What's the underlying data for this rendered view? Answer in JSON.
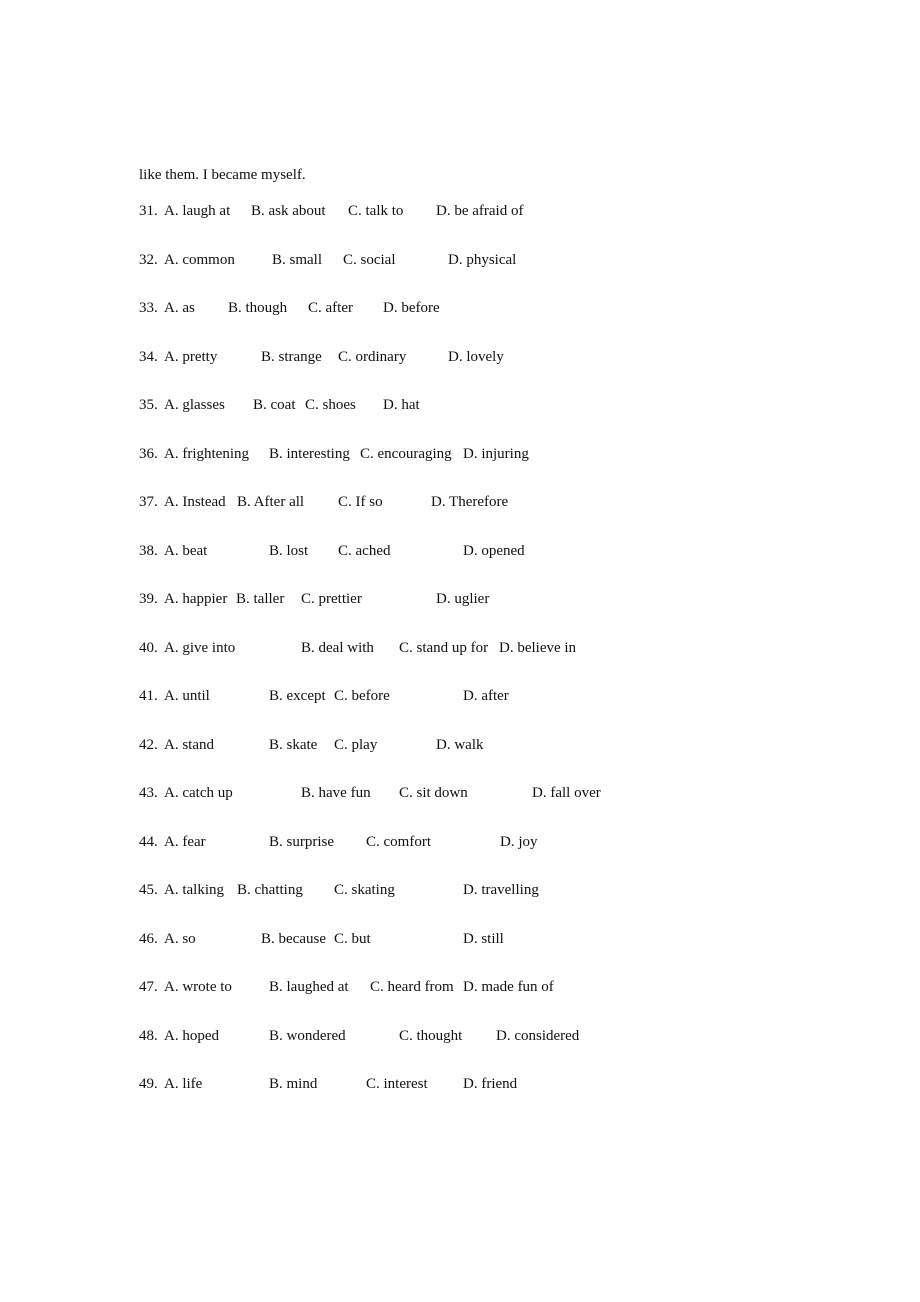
{
  "intro_line": "like them. I became myself.",
  "questions": [
    {
      "num": "31.",
      "options": [
        "A. laugh at",
        "B. ask about",
        "C. talk to",
        "D. be afraid of"
      ]
    },
    {
      "num": "32.",
      "options": [
        "A. common",
        "B. small",
        "C. social",
        "D. physical"
      ]
    },
    {
      "num": "33.",
      "options": [
        "A. as",
        "B. though",
        "C. after",
        "D. before"
      ]
    },
    {
      "num": "34.",
      "options": [
        "A. pretty",
        "B. strange",
        "C. ordinary",
        "D. lovely"
      ]
    },
    {
      "num": "35.",
      "options": [
        "A. glasses",
        "B. coat",
        "C. shoes",
        "D. hat"
      ]
    },
    {
      "num": "36.",
      "options": [
        "A. frightening",
        "B. interesting",
        "C. encouraging",
        "D. injuring"
      ]
    },
    {
      "num": "37.",
      "options": [
        "A. Instead",
        "B. After all",
        "C. If so",
        "D. Therefore"
      ]
    },
    {
      "num": "38.",
      "options": [
        "A. beat",
        "B. lost",
        "C. ached",
        "D. opened"
      ]
    },
    {
      "num": "39.",
      "options": [
        "A. happier",
        "B. taller",
        "C. prettier",
        "D. uglier"
      ]
    },
    {
      "num": "40.",
      "options": [
        "A. give into",
        "B. deal with",
        "C. stand up for",
        "D. believe in"
      ]
    },
    {
      "num": "41.",
      "options": [
        "A. until",
        "B. except",
        "C. before",
        "D. after"
      ]
    },
    {
      "num": "42.",
      "options": [
        "A. stand",
        "B. skate",
        "C. play",
        "D. walk"
      ]
    },
    {
      "num": "43.",
      "options": [
        "A. catch up",
        "B. have fun",
        "C. sit down",
        "D. fall over"
      ]
    },
    {
      "num": "44.",
      "options": [
        "A. fear",
        "B. surprise",
        "C. comfort",
        "D. joy"
      ]
    },
    {
      "num": "45.",
      "options": [
        "A. talking",
        "B. chatting",
        "C. skating",
        "D. travelling"
      ]
    },
    {
      "num": "46.",
      "options": [
        "A. so",
        "B. because",
        "C. but",
        "D. still"
      ]
    },
    {
      "num": "47.",
      "options": [
        "A. wrote to",
        "B. laughed at",
        "C. heard from",
        "D. made fun of"
      ]
    },
    {
      "num": "48.",
      "options": [
        "A. hoped",
        "B. wondered",
        "C. thought",
        "D. considered"
      ]
    },
    {
      "num": "49.",
      "options": [
        "A. life",
        "B. mind",
        "C. interest",
        "D. friend"
      ]
    }
  ]
}
